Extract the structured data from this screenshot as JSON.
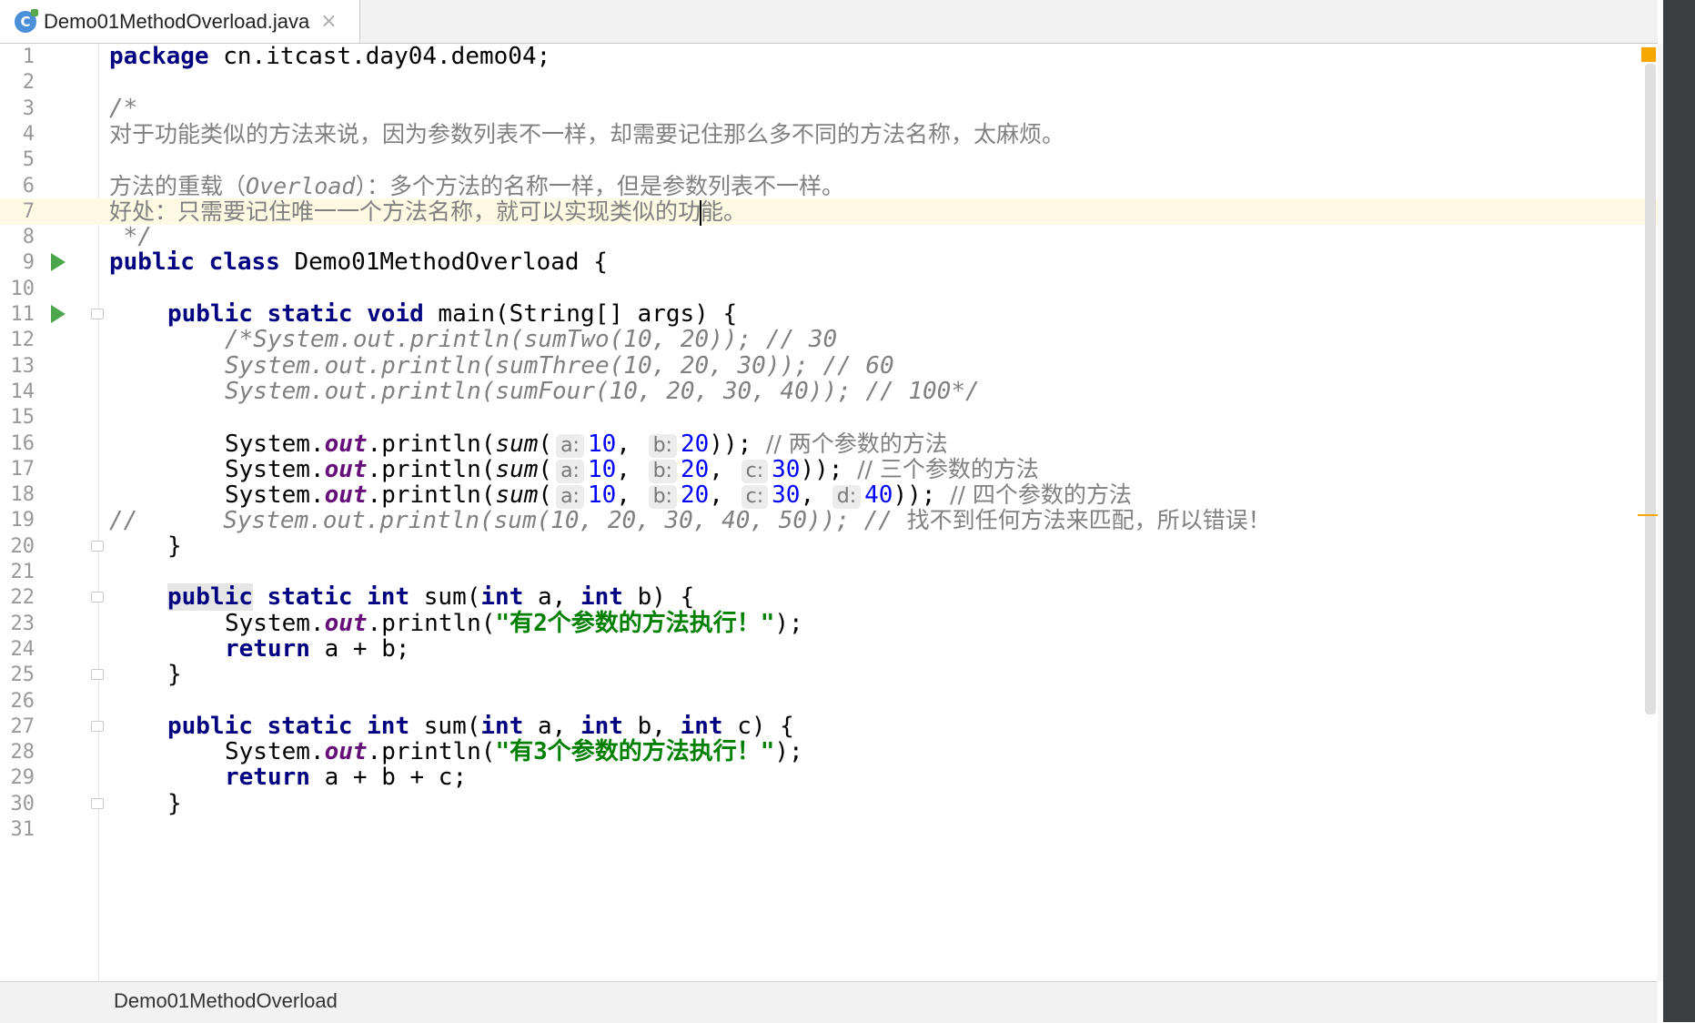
{
  "tab": {
    "icon_letter": "C",
    "label": "Demo01MethodOverload.java",
    "close": "×"
  },
  "breadcrumb": {
    "label": "Demo01MethodOverload"
  },
  "lines": {
    "1": {
      "kw": "package",
      "rest": " cn.itcast.day04.demo04;"
    },
    "3": "/*",
    "4": "对于功能类似的方法来说，因为参数列表不一样，却需要记住那么多不同的方法名称，太麻烦。",
    "6": {
      "a": "方法的重载（",
      "b": "Overload",
      "c": "）：多个方法的名称一样，但是参数列表不一样。"
    },
    "7": {
      "a": "好处：只需要记住唯一一个方法名称，就可以实现类似的功",
      "b": "能。"
    },
    "8": " */",
    "9": {
      "kw": "public class",
      "rest": " Demo01MethodOverload {"
    },
    "11": {
      "kw": "public static void",
      "rest": " main(String[] args) {"
    },
    "12": "/*System.out.println(sumTwo(10, 20)); // 30",
    "13": "System.out.println(sumThree(10, 20, 30)); // 60",
    "14": "System.out.println(sumFour(10, 20, 30, 40)); // 100*/",
    "16": {
      "comment": "// 两个参数的方法"
    },
    "17": {
      "comment": "// 三个参数的方法"
    },
    "18": {
      "comment": "// 四个参数的方法"
    },
    "19": {
      "a": "//      System.out.println(sum(10, 20, 30, 40, 50)); // ",
      "b": "找不到任何方法来匹配，所以错误！"
    },
    "20": "}",
    "22": {
      "kw1": "public",
      "kw2": " static int",
      "rest": " sum(",
      "kw3": "int",
      "rest2": " a, ",
      "kw4": "int",
      "rest3": " b) {"
    },
    "23": {
      "str": "\"有2个参数的方法执行！\""
    },
    "24": {
      "kw": "return",
      "rest": " a + b;"
    },
    "25": "}",
    "27": {
      "kw": "public static int",
      "rest": " sum(",
      "kw3": "int",
      "rest2": " a, ",
      "kw4": "int",
      "rest3": " b, ",
      "kw5": "int",
      "rest4": " c) {"
    },
    "28": {
      "str": "\"有3个参数的方法执行！\""
    },
    "29": {
      "kw": "return",
      "rest": " a + b + c;"
    },
    "30": "}"
  },
  "tokens": {
    "sysout": "System.",
    "out": "out",
    "println": ".println(",
    "sum": "sum",
    "paren": "(",
    "end2": "));",
    "end1": ");",
    "comma": ", ",
    "a": "a:",
    "b": "b:",
    "c": "c:",
    "d": "d:",
    "v10": "10",
    "v20": "20",
    "v30": "30",
    "v40": "40"
  },
  "line_numbers": [
    "1",
    "2",
    "3",
    "4",
    "5",
    "6",
    "7",
    "8",
    "9",
    "10",
    "11",
    "12",
    "13",
    "14",
    "15",
    "16",
    "17",
    "18",
    "19",
    "20",
    "21",
    "22",
    "23",
    "24",
    "25",
    "26",
    "27",
    "28",
    "29",
    "30",
    "31"
  ]
}
